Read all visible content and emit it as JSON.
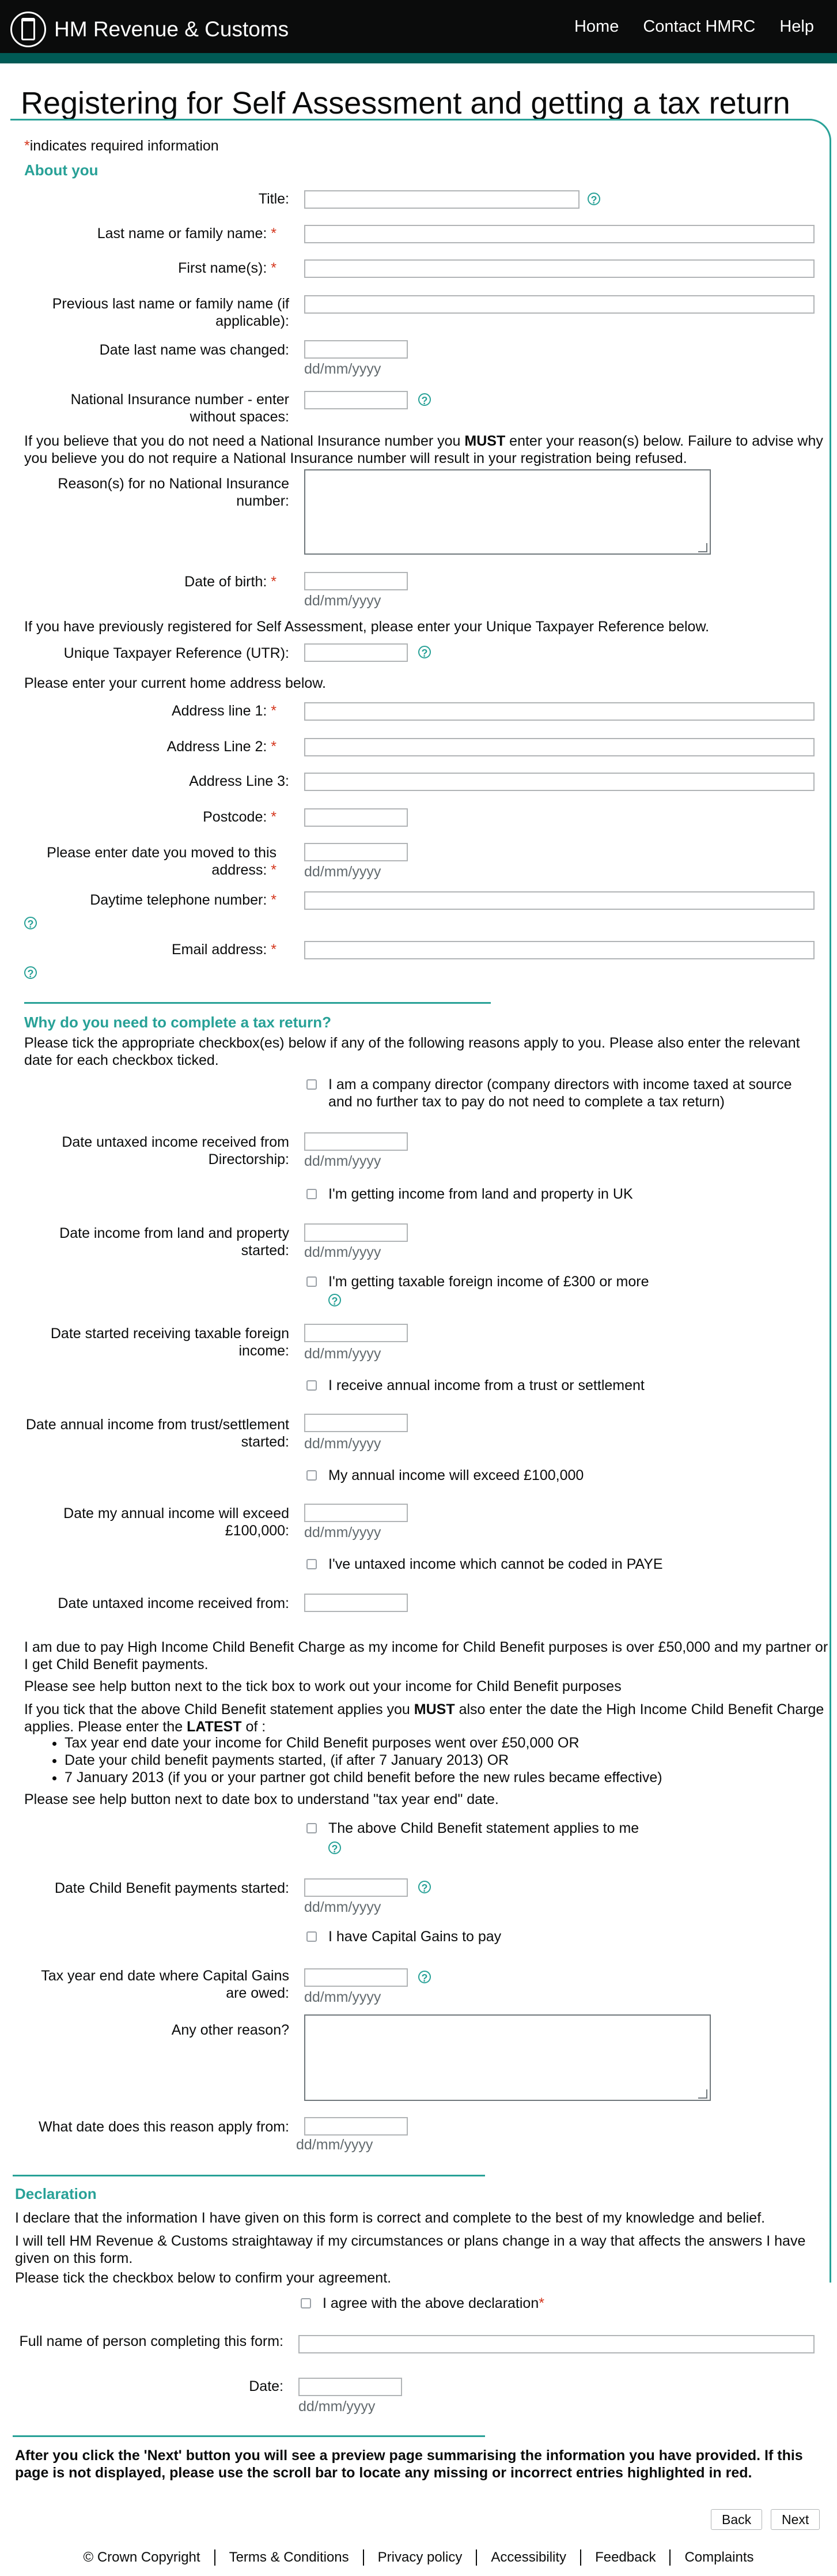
{
  "header": {
    "brand": "HM Revenue & Customs",
    "nav": [
      "Home",
      "Contact HMRC",
      "Help"
    ]
  },
  "page": {
    "title": "Registering for Self Assessment and getting a tax return",
    "required_note": "indicates required information",
    "about_you": "About you",
    "labels": {
      "title": "Title:",
      "last_name": "Last name or family name:",
      "first_names": "First name(s):",
      "prev_last_name": "Previous last name or family name (if applicable):",
      "date_last_changed": "Date last name was changed:",
      "ni_number": "National Insurance number - enter without spaces:",
      "no_ni_reason": "Reason(s) for no National Insurance number:",
      "dob": "Date of birth:",
      "utr": "Unique Taxpayer Reference (UTR):",
      "addr1": "Address line 1:",
      "addr2": "Address Line 2:",
      "addr3": "Address Line 3:",
      "postcode": "Postcode:",
      "date_moved": "Please enter date you moved to this address:",
      "phone": "Daytime telephone number:",
      "email": "Email address:"
    },
    "texts": {
      "ni_notice_1": "If you believe that you do not need a National Insurance number you ",
      "must": "MUST",
      "ni_notice_2": " enter your reason(s) below. Failure to advise why you believe you do not require a National Insurance number will result in your registration being refused.",
      "utr_intro": "If you have previously registered for Self Assessment, please enter your Unique Taxpayer Reference below.",
      "addr_intro": "Please enter your current home address below."
    },
    "why_heading": "Why do you need to complete a tax return?",
    "why_intro": "Please tick the appropriate checkbox(es) below if any of the following reasons apply to you. Please also enter the relevant date for each checkbox ticked.",
    "reasons": {
      "director": "I am a company director (company directors with income taxed at source and no further tax to pay do not need to complete a tax return)",
      "director_date": "Date untaxed income received from Directorship:",
      "property": "I'm getting income from land and property in UK",
      "property_date": "Date income from land and property started:",
      "foreign": "I'm getting taxable foreign income of £300 or more",
      "foreign_date": "Date started receiving taxable foreign income:",
      "trust": "I receive annual income from a trust or settlement",
      "trust_date": "Date annual income from trust/settlement started:",
      "over100k": "My annual income will exceed £100,000",
      "over100k_date": "Date my annual income will exceed £100,000:",
      "untaxed": "I've untaxed income which cannot be coded in PAYE",
      "untaxed_date": "Date untaxed income received from:"
    },
    "child_benefit": {
      "p1": "I am due to pay High Income Child Benefit Charge as my income for Child Benefit purposes is over £50,000 and my partner or I get Child Benefit payments.",
      "p2": "Please see help button next to the tick box to work out your income for Child Benefit purposes",
      "p3a": "If you tick that the above Child Benefit statement applies you ",
      "p3b": " also enter the date the High Income Child Benefit Charge applies. Please enter the ",
      "latest": "LATEST",
      "p3c": " of :",
      "bullets": [
        "Tax year end date your income for Child Benefit purposes went over £50,000 OR",
        "Date your child benefit payments started, (if after 7 January 2013) OR",
        "7 January 2013 (if you or your partner got child benefit before the new rules became effective)"
      ],
      "p4": "Please see help button next to date box to understand \"tax year end\" date.",
      "applies": "The above Child Benefit statement applies to me",
      "applies_date": "Date Child Benefit payments started:"
    },
    "cgt": "I have Capital Gains to pay",
    "cgt_date": "Tax year end date where Capital Gains are owed:",
    "other_reason": "Any other reason?",
    "other_date": "What date does this reason apply from:",
    "declaration": {
      "heading": "Declaration",
      "p1": "I declare that the information I have given on this form is correct and complete to the best of my knowledge and belief.",
      "p2": "I will tell HM Revenue & Customs straightaway if my circumstances or plans change in a way that affects the answers I have given on this form.",
      "p3": "Please tick the checkbox below to confirm your agreement.",
      "agree": "I agree with the above declaration",
      "full_name": "Full name of person completing this form:",
      "date": "Date:"
    },
    "next_notice": "After you click the 'Next' button you will see a preview page summarising the information you have provided. If this page is not displayed, please use the scroll bar to locate any missing or incorrect entries highlighted in red.",
    "date_hint": "dd/mm/yyyy",
    "help_glyph": "?",
    "req_mark": "*",
    "buttons": {
      "back": "Back",
      "next": "Next"
    }
  },
  "footer": [
    "© Crown Copyright",
    "Terms & Conditions",
    "Privacy policy",
    "Accessibility",
    "Feedback",
    "Complaints"
  ],
  "colors": {
    "accent": "#28a197",
    "header": "#0b0c0c",
    "stripe": "#005a55",
    "required": "#d4351c"
  }
}
